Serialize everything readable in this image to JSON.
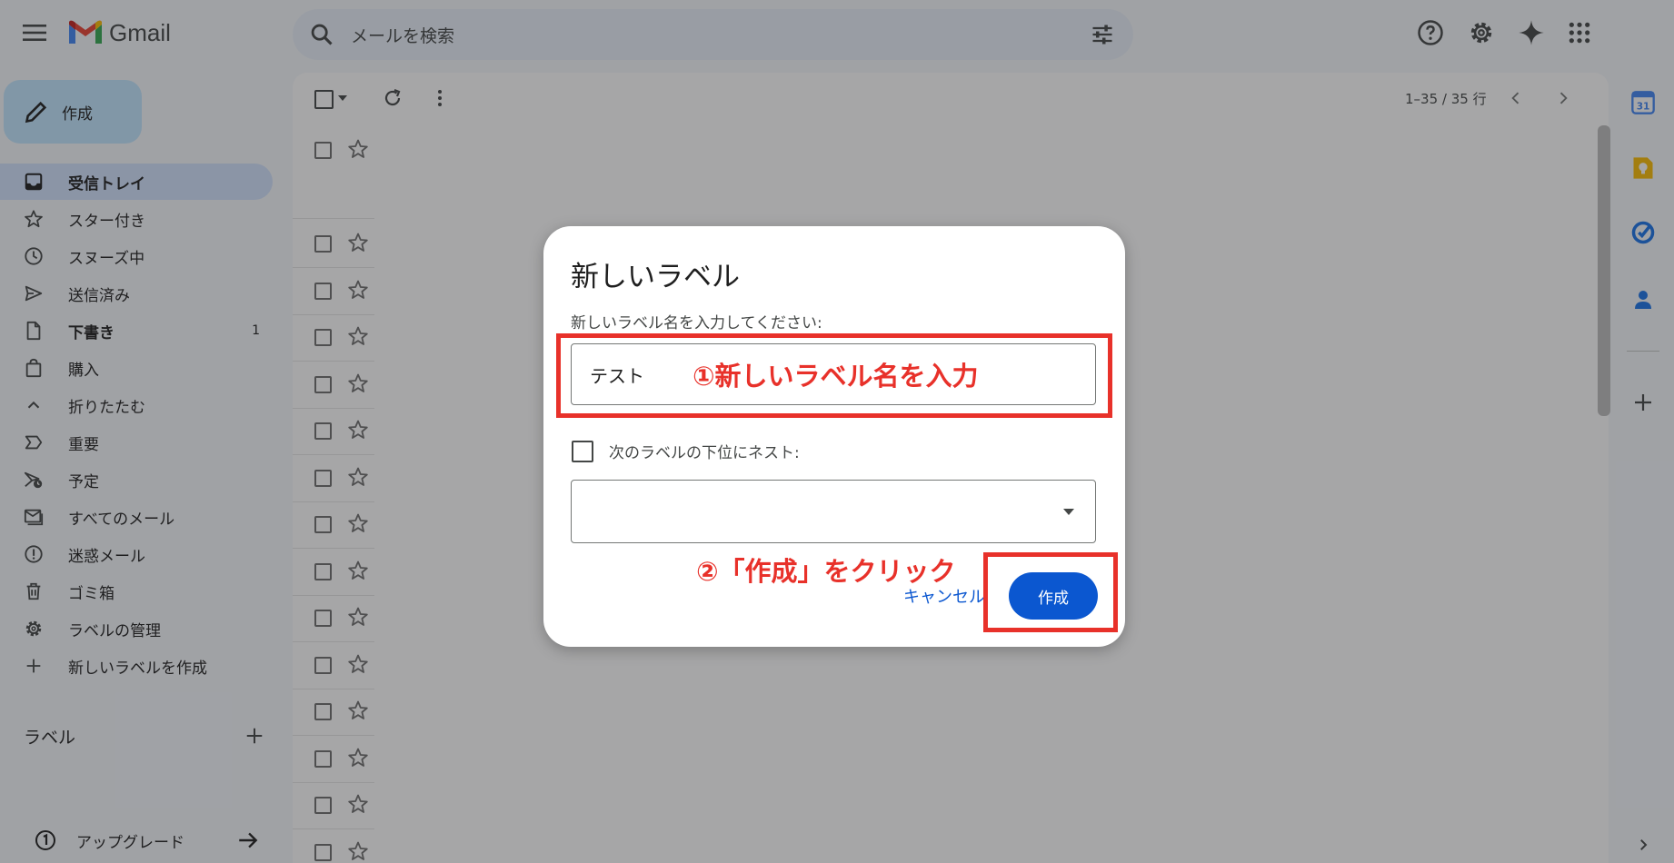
{
  "app": {
    "name": "Gmail"
  },
  "search": {
    "placeholder": "メールを検索"
  },
  "compose": {
    "label": "作成"
  },
  "sidebar": {
    "items": [
      {
        "label": "受信トレイ",
        "icon": "inbox-icon",
        "count": ""
      },
      {
        "label": "スター付き",
        "icon": "star-icon",
        "count": ""
      },
      {
        "label": "スヌーズ中",
        "icon": "clock-icon",
        "count": ""
      },
      {
        "label": "送信済み",
        "icon": "send-icon",
        "count": ""
      },
      {
        "label": "下書き",
        "icon": "draft-icon",
        "count": "1"
      },
      {
        "label": "購入",
        "icon": "shopping-bag-icon",
        "count": ""
      },
      {
        "label": "折りたたむ",
        "icon": "chevron-up-icon",
        "count": ""
      },
      {
        "label": "重要",
        "icon": "important-icon",
        "count": ""
      },
      {
        "label": "予定",
        "icon": "scheduled-icon",
        "count": ""
      },
      {
        "label": "すべてのメール",
        "icon": "all-mail-icon",
        "count": ""
      },
      {
        "label": "迷惑メール",
        "icon": "spam-icon",
        "count": ""
      },
      {
        "label": "ゴミ箱",
        "icon": "trash-icon",
        "count": ""
      },
      {
        "label": "ラベルの管理",
        "icon": "gear-icon",
        "count": ""
      },
      {
        "label": "新しいラベルを作成",
        "icon": "plus-icon",
        "count": ""
      }
    ],
    "labels_header": "ラベル",
    "upgrade_label": "アップグレード"
  },
  "list": {
    "pager_text": "1–35 / 35 行"
  },
  "dialog": {
    "title": "新しいラベル",
    "prompt": "新しいラベル名を入力してください:",
    "input_value": "テスト",
    "nest_label": "次のラベルの下位にネスト:",
    "cancel_label": "キャンセル",
    "create_label": "作成"
  },
  "annotations": {
    "step1": "①新しいラベル名を入力",
    "step2": "②「作成」をクリック"
  },
  "colors": {
    "accent": "#0b57d0",
    "annotation": "#e8312a",
    "selected_nav": "#d3e3fd",
    "compose_bg": "#c2e7ff"
  }
}
